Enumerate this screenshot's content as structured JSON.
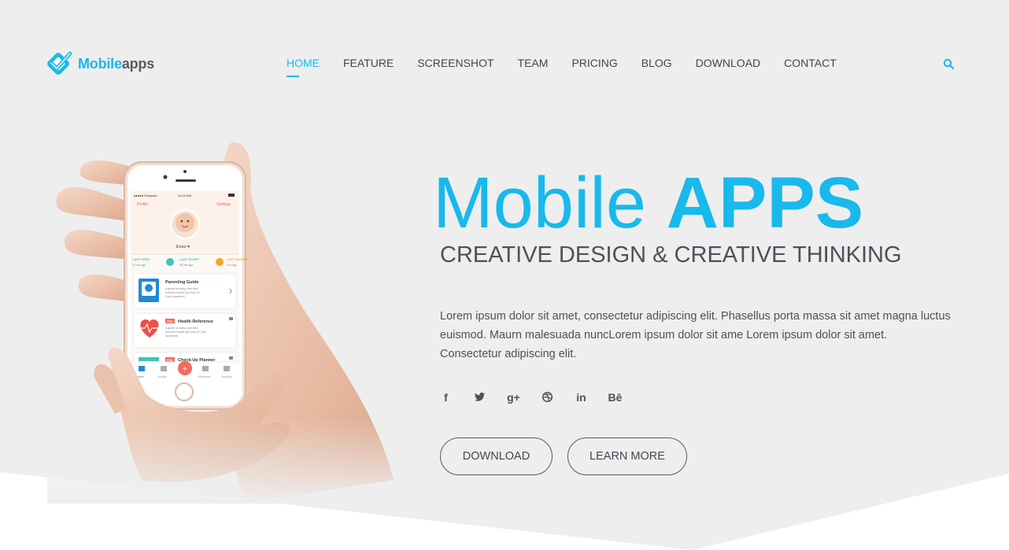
{
  "brand": {
    "name_part1": "Mobile",
    "name_part2": "apps"
  },
  "nav": {
    "items": [
      {
        "label": "HOME",
        "active": true
      },
      {
        "label": "FEATURE"
      },
      {
        "label": "SCREENSHOT"
      },
      {
        "label": "TEAM"
      },
      {
        "label": "PRICING"
      },
      {
        "label": "BLOG"
      },
      {
        "label": "DOWNLOAD"
      },
      {
        "label": "CONTACT"
      }
    ],
    "search_icon": "search-icon"
  },
  "hero": {
    "title_regular": "Mobile",
    "title_bold": "APPS",
    "subtitle": "CREATIVE DESIGN & CREATIVE THINKING",
    "text": "Lorem ipsum dolor sit amet, consectetur adipiscing elit. Phasellus porta massa sit amet magna luctus euismod. Maurn malesuada nuncLorem ipsum dolor sit ame Lorem ipsum dolor sit amet. Consectetur adipiscing elit.",
    "social": [
      {
        "icon": "facebook-icon",
        "glyph": "f"
      },
      {
        "icon": "twitter-icon"
      },
      {
        "icon": "google-plus-icon",
        "glyph": "g+"
      },
      {
        "icon": "dribbble-icon"
      },
      {
        "icon": "linkedin-icon",
        "glyph": "in"
      },
      {
        "icon": "behance-icon",
        "glyph": "Bē"
      }
    ],
    "buttons": {
      "download": "DOWNLOAD",
      "learn_more": "LEARN MORE"
    }
  },
  "phone": {
    "status_carrier": "●●●●● Kickpush",
    "status_time": "10:20 AM",
    "profile_label": "Profile",
    "settings_label": "Settings",
    "child_name": "Enzo ▾",
    "stats": [
      {
        "label": "LAST FEED",
        "value": "23 min ago",
        "color": "#5bc36a"
      },
      {
        "label": "LAST SLEEP",
        "value": "58 min ago",
        "color": "#3ec6b5"
      },
      {
        "label": "LAST DIAPER",
        "value": "2 hr ago",
        "color": "#f5a623"
      }
    ],
    "cards": [
      {
        "title": "Parenting Guide",
        "desc": "A guide for baby care that includes expert tips from Dr Care Anywhere"
      },
      {
        "badge": "PRO",
        "title": "Health Reference",
        "desc": "A guide for baby care that includes expert tips from Dr Care Anywhere"
      },
      {
        "badge": "PRO",
        "title": "Check-Up Planner"
      }
    ],
    "tabs": [
      "Home",
      "Activity",
      "Milestones",
      "Sessions"
    ]
  },
  "colors": {
    "accent": "#18b9ec",
    "text": "#4a525a",
    "background": "#eeeeee",
    "phone_accent": "#f26b5b"
  }
}
